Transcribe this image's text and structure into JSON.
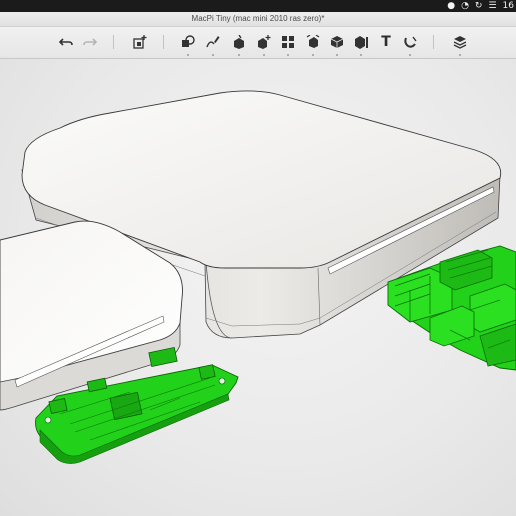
{
  "menubar": {
    "status_icons": [
      "person-icon",
      "time-machine-icon",
      "sync-icon",
      "wifi-icon"
    ],
    "clock_text": "16"
  },
  "window": {
    "title": "MacPi Tiny (mac mini 2010 ras zero)*"
  },
  "toolbar": {
    "tools": [
      {
        "name": "undo-icon"
      },
      {
        "name": "redo-icon",
        "disabled": true
      },
      {
        "name": "add-box-icon"
      },
      {
        "name": "shape-primitives-icon"
      },
      {
        "name": "sketch-icon"
      },
      {
        "name": "construct-icon"
      },
      {
        "name": "modify-icon"
      },
      {
        "name": "pattern-icon"
      },
      {
        "name": "grouping-icon"
      },
      {
        "name": "combine-icon"
      },
      {
        "name": "measure-icon"
      },
      {
        "name": "text-icon",
        "glyph": "T"
      },
      {
        "name": "snap-icon"
      },
      {
        "name": "material-icon"
      }
    ]
  },
  "scene": {
    "objects": [
      "mac-mini-large",
      "mac-mini-small",
      "raspberry-pi-zero-board",
      "raspberry-pi-board"
    ],
    "board_color": "#22d11a",
    "case_color": "#f2f0ee"
  }
}
